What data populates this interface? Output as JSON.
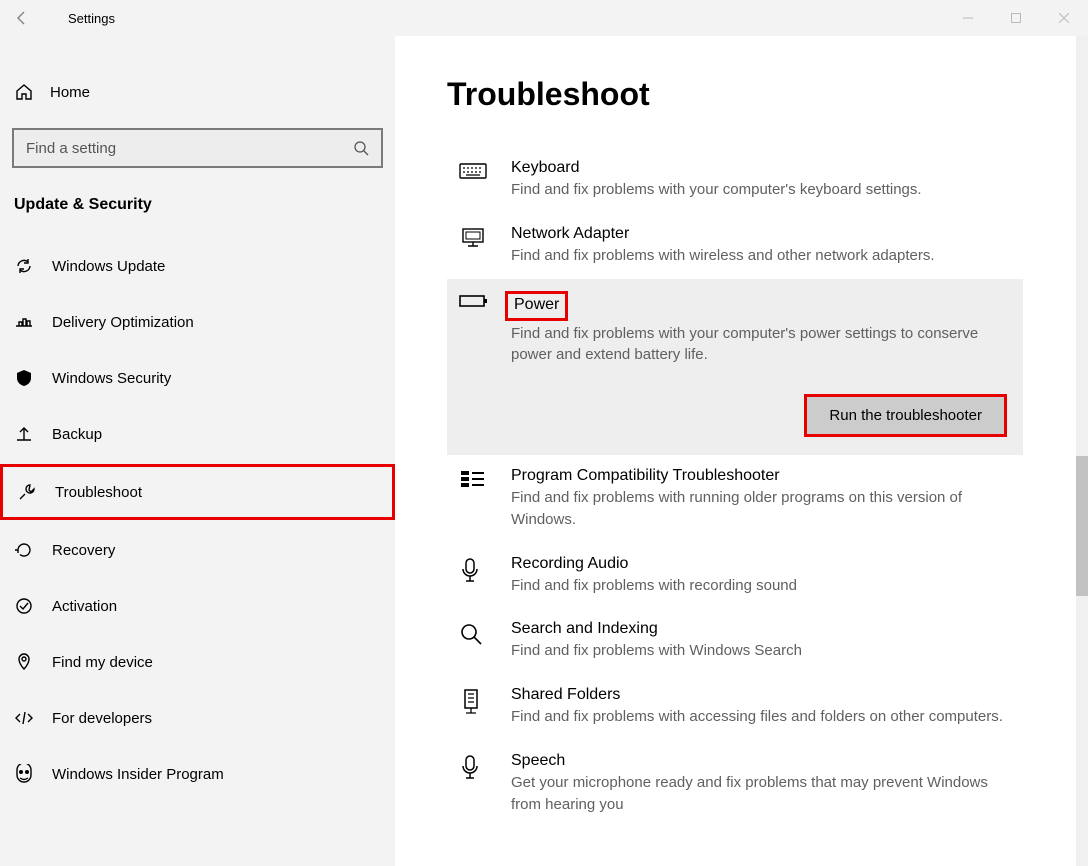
{
  "titlebar": {
    "title": "Settings"
  },
  "sidebar": {
    "home": "Home",
    "search_placeholder": "Find a setting",
    "section": "Update & Security",
    "items": [
      {
        "label": "Windows Update"
      },
      {
        "label": "Delivery Optimization"
      },
      {
        "label": "Windows Security"
      },
      {
        "label": "Backup"
      },
      {
        "label": "Troubleshoot"
      },
      {
        "label": "Recovery"
      },
      {
        "label": "Activation"
      },
      {
        "label": "Find my device"
      },
      {
        "label": "For developers"
      },
      {
        "label": "Windows Insider Program"
      }
    ]
  },
  "main": {
    "heading": "Troubleshoot",
    "items": [
      {
        "title": "Keyboard",
        "desc": "Find and fix problems with your computer's keyboard settings."
      },
      {
        "title": "Network Adapter",
        "desc": "Find and fix problems with wireless and other network adapters."
      },
      {
        "title": "Power",
        "desc": "Find and fix problems with your computer's power settings to conserve power and extend battery life.",
        "expanded": true
      },
      {
        "title": "Program Compatibility Troubleshooter",
        "desc": "Find and fix problems with running older programs on this version of Windows."
      },
      {
        "title": "Recording Audio",
        "desc": "Find and fix problems with recording sound"
      },
      {
        "title": "Search and Indexing",
        "desc": "Find and fix problems with Windows Search"
      },
      {
        "title": "Shared Folders",
        "desc": "Find and fix problems with accessing files and folders on other computers."
      },
      {
        "title": "Speech",
        "desc": "Get your microphone ready and fix problems that may prevent Windows from hearing you"
      }
    ],
    "run_button": "Run the troubleshooter"
  },
  "highlight": {
    "sidebar_index": 4,
    "expanded_index": 2
  }
}
